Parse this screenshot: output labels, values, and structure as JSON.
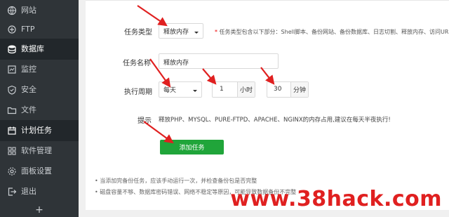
{
  "sidebar": {
    "items": [
      {
        "label": "网站",
        "icon": "globe-icon",
        "active": false
      },
      {
        "label": "FTP",
        "icon": "ftp-icon",
        "active": false
      },
      {
        "label": "数据库",
        "icon": "database-icon",
        "active": true
      },
      {
        "label": "监控",
        "icon": "monitor-icon",
        "active": false
      },
      {
        "label": "安全",
        "icon": "shield-icon",
        "active": false
      },
      {
        "label": "文件",
        "icon": "folder-icon",
        "active": false
      },
      {
        "label": "计划任务",
        "icon": "calendar-icon",
        "active": true
      },
      {
        "label": "软件管理",
        "icon": "grid-icon",
        "active": false
      },
      {
        "label": "面板设置",
        "icon": "gear-icon",
        "active": false
      },
      {
        "label": "退出",
        "icon": "logout-icon",
        "active": false
      }
    ],
    "add_label": "+"
  },
  "form": {
    "task_type_label": "任务类型",
    "task_type_value": "释放内存",
    "task_type_note_star": "*",
    "task_type_note": "任务类型包含以下部分：Shell脚本、备份网站、备份数据库、日志切割、释放内存、访问URL",
    "task_name_label": "任务名称",
    "task_name_value": "释放内存",
    "period_label": "执行周期",
    "period_value": "每天",
    "hour_value": "1",
    "hour_unit": "小时",
    "minute_value": "30",
    "minute_unit": "分钟",
    "tip_label": "提示",
    "tip_text": "释放PHP、MYSQL、PURE-FTPD、APACHE、NGINX的内存占用,建议在每天半夜执行!",
    "submit_label": "添加任务"
  },
  "footer_notes": [
    "当添加完备份任务，应该手动运行一次，并检查备份包是否完整",
    "磁盘容量不够、数据库密码错误、网络不稳定等原因，可能导致数据备份不完整"
  ],
  "watermark": "www.38hack.com",
  "colors": {
    "sidebar_bg": "#2f3438",
    "accent_green": "#20a53a",
    "arrow_red": "#e02020"
  }
}
